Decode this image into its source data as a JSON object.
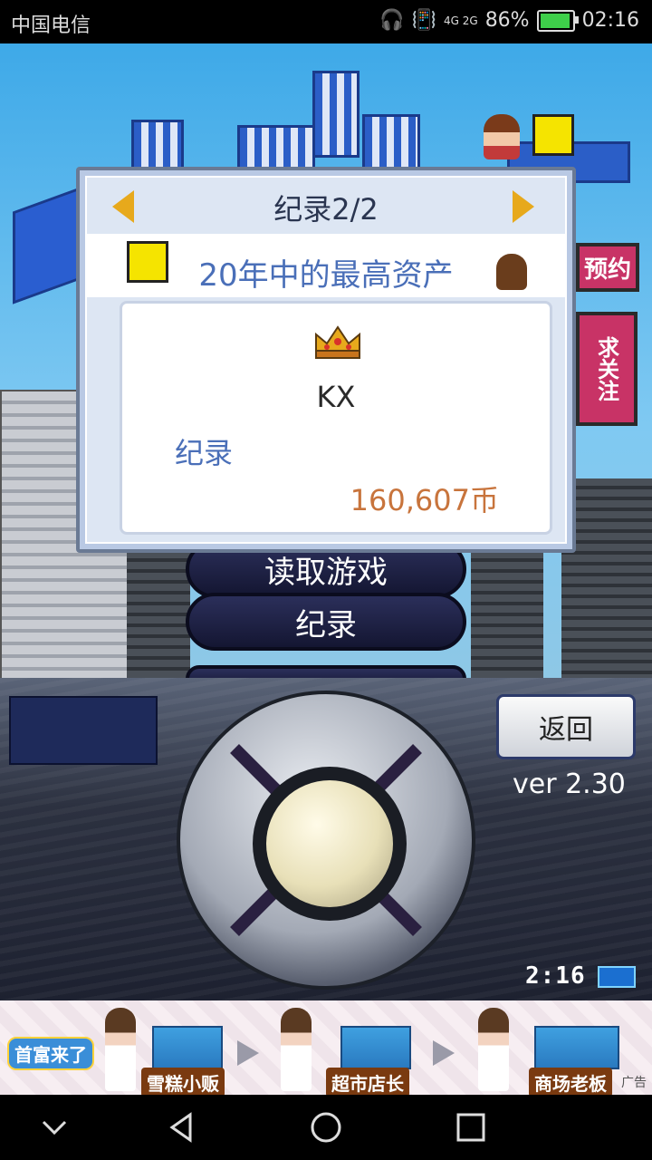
{
  "status_bar": {
    "carrier": "中国电信",
    "network": "4G 2G",
    "battery_percent_label": "86%",
    "battery_level": 0.86,
    "time": "02:16"
  },
  "menu": {
    "load_game_label": "读取游戏",
    "records_label": "纪录"
  },
  "dialog": {
    "title": "纪录2/2",
    "subtitle": "20年中的最高资产",
    "player_name": "KX",
    "record_label": "纪录",
    "record_value": "160,607币"
  },
  "controller": {
    "back_label": "返回",
    "version": "ver 2.30",
    "clock": "2:16"
  },
  "ad": {
    "logo": "首富来了",
    "stage1": "雪糕小贩",
    "stage2": "超市店长",
    "stage3": "商场老板",
    "tag": "广告"
  },
  "signs": {
    "sign_top": "预约",
    "sign_bottom": "求关注"
  },
  "colors": {
    "accent_blue": "#4a6fb8",
    "value_orange": "#c8743c",
    "arrow_gold": "#e7a91c"
  }
}
